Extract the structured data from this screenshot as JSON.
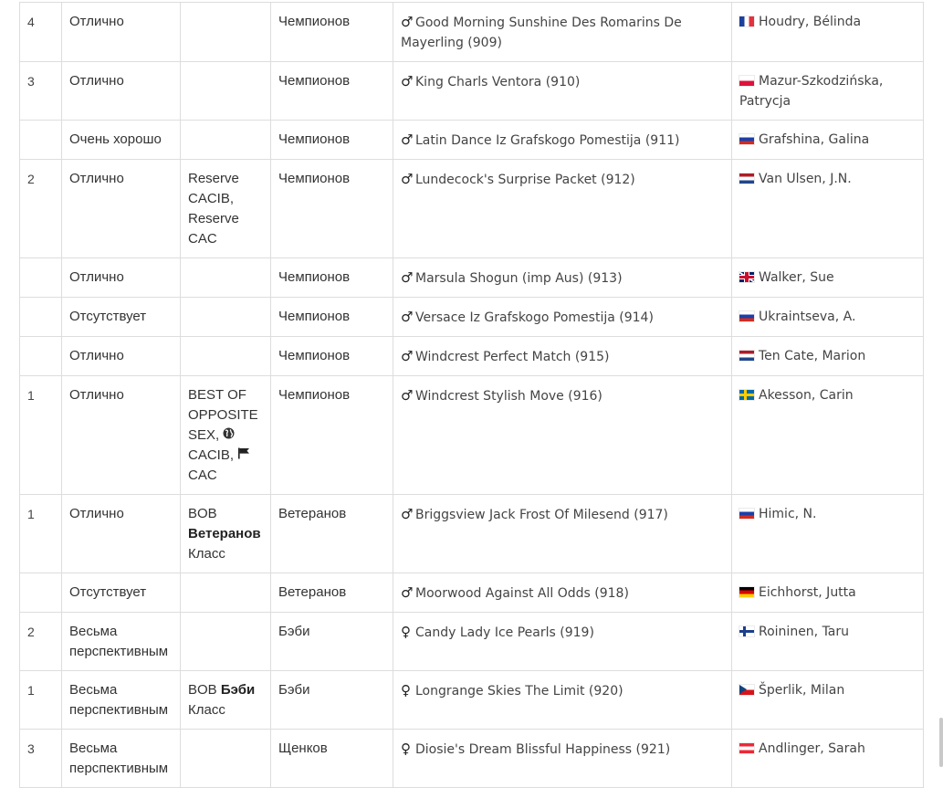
{
  "icons": {
    "male": "♂",
    "female": "♀",
    "globe": "globe-icon",
    "flag": "flag-icon"
  },
  "rows": [
    {
      "place": "4",
      "grade": "Отлично",
      "award": [],
      "class": "Чемпионов",
      "sex": "male",
      "dog": "Good Morning Sunshine Des Romarins De Mayerling (909)",
      "country": "fr",
      "owner": "Houdry, Bélinda"
    },
    {
      "place": "3",
      "grade": "Отлично",
      "award": [],
      "class": "Чемпионов",
      "sex": "male",
      "dog": "King Charls Ventora (910)",
      "country": "pl",
      "owner": "Mazur-Szkodzińska, Patrycja"
    },
    {
      "place": "",
      "grade": "Очень хорошо",
      "award": [],
      "class": "Чемпионов",
      "sex": "male",
      "dog": "Latin Dance Iz Grafskogo Pomestija (911)",
      "country": "ru",
      "owner": "Grafshina, Galina"
    },
    {
      "place": "2",
      "grade": "Отлично",
      "award": [
        {
          "t": "Reserve CACIB, Reserve CAC"
        }
      ],
      "class": "Чемпионов",
      "sex": "male",
      "dog": "Lundecock's Surprise Packet (912)",
      "country": "nl",
      "owner": "Van Ulsen, J.N."
    },
    {
      "place": "",
      "grade": "Отлично",
      "award": [],
      "class": "Чемпионов",
      "sex": "male",
      "dog": "Marsula Shogun (imp Aus) (913)",
      "country": "gb",
      "owner": "Walker, Sue"
    },
    {
      "place": "",
      "grade": "Отсутствует",
      "award": [],
      "class": "Чемпионов",
      "sex": "male",
      "dog": "Versace Iz Grafskogo Pomestija (914)",
      "country": "ru",
      "owner": "Ukraintseva, A."
    },
    {
      "place": "",
      "grade": "Отлично",
      "award": [],
      "class": "Чемпионов",
      "sex": "male",
      "dog": "Windcrest Perfect Match (915)",
      "country": "nl",
      "owner": "Ten Cate, Marion"
    },
    {
      "place": "1",
      "grade": "Отлично",
      "award": [
        {
          "t": "BEST OF OPPOSITE SEX, "
        },
        {
          "icon": "globe"
        },
        {
          "t": " CACIB, "
        },
        {
          "icon": "flag"
        },
        {
          "t": " CAC"
        }
      ],
      "class": "Чемпионов",
      "sex": "male",
      "dog": "Windcrest Stylish Move (916)",
      "country": "se",
      "owner": "Akesson, Carin"
    },
    {
      "place": "1",
      "grade": "Отлично",
      "award": [
        {
          "t": "BOB "
        },
        {
          "b": "Ветеранов"
        },
        {
          "t": " Класс"
        }
      ],
      "class": "Ветеранов",
      "sex": "male",
      "dog": "Briggsview Jack Frost Of Milesend (917)",
      "country": "ru",
      "owner": "Himic, N."
    },
    {
      "place": "",
      "grade": "Отсутствует",
      "award": [],
      "class": "Ветеранов",
      "sex": "male",
      "dog": "Moorwood Against All Odds (918)",
      "country": "de",
      "owner": "Eichhorst, Jutta"
    },
    {
      "place": "2",
      "grade": "Весьма перспективным",
      "award": [],
      "class": "Бэби",
      "sex": "female",
      "dog": "Candy Lady Ice Pearls (919)",
      "country": "fi",
      "owner": "Roininen, Taru"
    },
    {
      "place": "1",
      "grade": "Весьма перспективным",
      "award": [
        {
          "t": "BOB "
        },
        {
          "b": "Бэби"
        },
        {
          "t": " Класс"
        }
      ],
      "class": "Бэби",
      "sex": "female",
      "dog": "Longrange Skies The Limit (920)",
      "country": "cz",
      "owner": "Šperlik, Milan"
    },
    {
      "place": "3",
      "grade": "Весьма перспективным",
      "award": [],
      "class": "Щенков",
      "sex": "female",
      "dog": "Diosie's Dream Blissful Happiness (921)",
      "country": "at",
      "owner": "Andlinger, Sarah"
    }
  ]
}
